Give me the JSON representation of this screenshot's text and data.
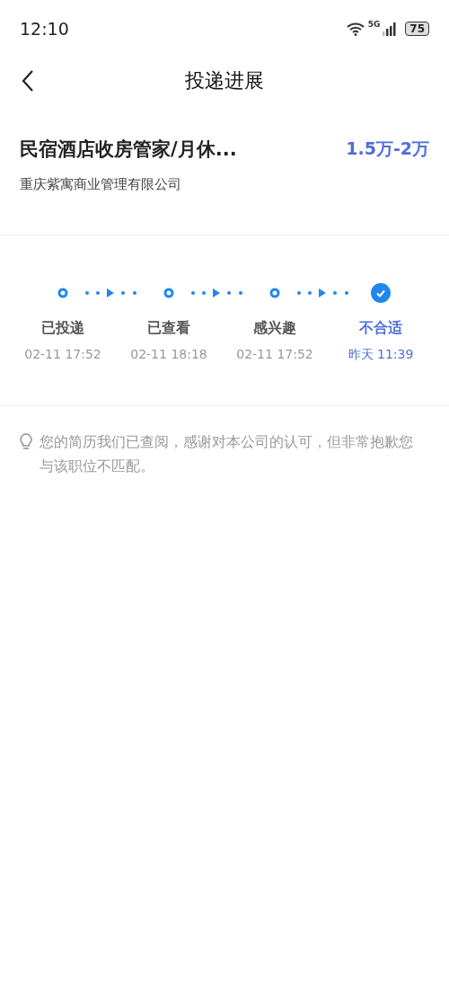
{
  "status_bar": {
    "time": "12:10",
    "network": "5G",
    "battery": "75"
  },
  "nav": {
    "title": "投递进展"
  },
  "job": {
    "title": "民宿酒店收房管家/月休...",
    "salary": "1.5万-2万",
    "company": "重庆紫寓商业管理有限公司"
  },
  "steps": [
    {
      "label": "已投递",
      "time": "02-11 17:52",
      "selected": false
    },
    {
      "label": "已查看",
      "time": "02-11 18:18",
      "selected": false
    },
    {
      "label": "感兴趣",
      "time": "02-11 17:52",
      "selected": false
    },
    {
      "label": "不合适",
      "time": "昨天 11:39",
      "selected": true
    }
  ],
  "note": {
    "text": "您的简历我们已查阅，感谢对本公司的认可，但非常抱歉您与该职位不匹配。"
  }
}
